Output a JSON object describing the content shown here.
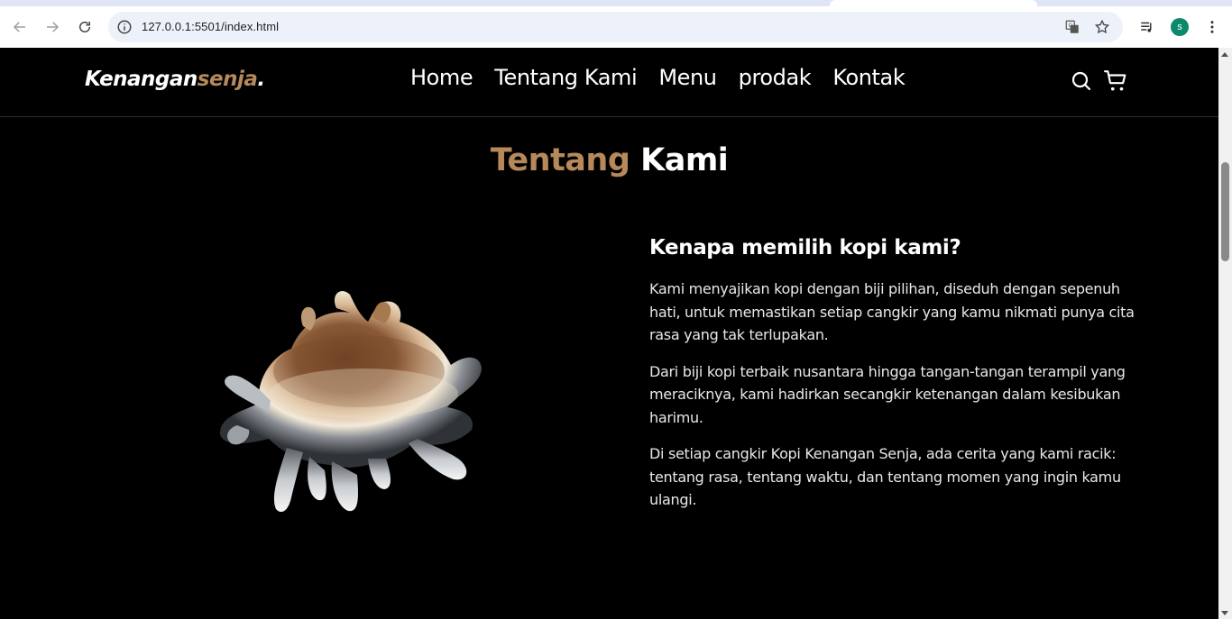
{
  "browser": {
    "url": "127.0.0.1:5501/index.html",
    "profile_initial": "s",
    "icons": [
      "back-icon",
      "forward-icon",
      "reload-icon",
      "site-info-icon",
      "translate-icon",
      "bookmark-star-icon",
      "media-icon",
      "kebab-menu-icon"
    ]
  },
  "navbar": {
    "logo_main": "Kenangan",
    "logo_accent": "senja",
    "logo_dot": ".",
    "links": [
      "Home",
      "Tentang Kami",
      "Menu",
      "prodak",
      "Kontak"
    ],
    "icons": [
      "search-icon",
      "cart-icon"
    ]
  },
  "about": {
    "title_accent": "Tentang",
    "title_main": "Kami",
    "heading": "Kenapa memilih kopi kami?",
    "paragraphs": [
      "Kami menyajikan kopi dengan biji pilihan, diseduh dengan sepenuh hati, untuk memastikan setiap cangkir yang kamu nikmati punya cita rasa yang tak terlupakan.",
      "Dari biji kopi terbaik nusantara hingga tangan-tangan terampil yang meraciknya, kami hadirkan secangkir ketenangan dalam kesibukan harimu.",
      "Di setiap cangkir Kopi Kenangan Senja, ada cerita yang kami racik: tentang rasa, tentang waktu, dan tentang momen yang ingin kamu ulangi."
    ]
  },
  "colors": {
    "accent": "#b6895b",
    "background": "#000000",
    "text": "#ffffff"
  }
}
